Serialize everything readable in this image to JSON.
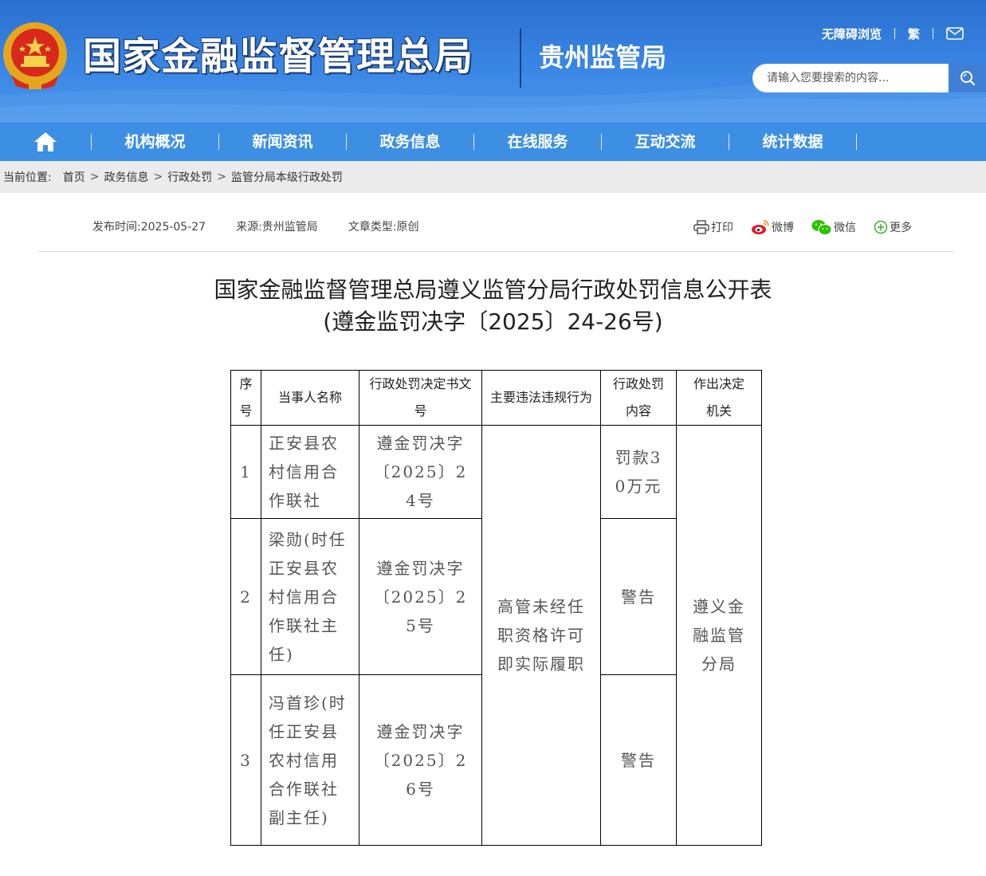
{
  "header": {
    "main_title": "国家金融监督管理总局",
    "sub_title": "贵州监管局",
    "links": {
      "accessibility": "无障碍浏览",
      "traditional": "繁"
    },
    "search_placeholder": "请输入您要搜索的内容..."
  },
  "nav": {
    "items": [
      {
        "label": "机构概况"
      },
      {
        "label": "新闻资讯"
      },
      {
        "label": "政务信息"
      },
      {
        "label": "在线服务"
      },
      {
        "label": "互动交流"
      },
      {
        "label": "统计数据"
      }
    ]
  },
  "breadcrumb": {
    "label": "当前位置:",
    "items": [
      "首页",
      "政务信息",
      "行政处罚",
      "监管分局本级行政处罚"
    ],
    "separator": ">"
  },
  "meta": {
    "publish_time": "发布时间:2025-05-27",
    "source": "来源:贵州监管局",
    "article_type": "文章类型:原创"
  },
  "share": {
    "print": "打印",
    "weibo": "微博",
    "wechat": "微信",
    "more": "更多"
  },
  "article": {
    "title_line1": "国家金融监督管理总局遵义监管分局行政处罚信息公开表",
    "title_line2": "(遵金监罚决字〔2025〕24-26号)"
  },
  "table": {
    "headers": [
      "序号",
      "当事人名称",
      "行政处罚决定书文号",
      "主要违法违规行为",
      "行政处罚内容",
      "作出决定机关"
    ],
    "rows": [
      {
        "no": "1",
        "party": "正安县农村信用合作联社",
        "doc": "遵金罚决字〔2025〕24号",
        "penalty": "罚款30万元"
      },
      {
        "no": "2",
        "party": "梁勋(时任正安县农村信用合作联社主任)",
        "doc": "遵金罚决字〔2025〕25号",
        "penalty": "警告"
      },
      {
        "no": "3",
        "party": "冯首珍(时任正安县农村信用合作联社副主任)",
        "doc": "遵金罚决字〔2025〕26号",
        "penalty": "警告"
      }
    ],
    "violation": "高管未经任职资格许可即实际履职",
    "authority": "遵义金融监管分局"
  },
  "colors": {
    "header_blue": "#3a86e4",
    "nav_blue": "#3d8fe4",
    "breadcrumb_bg": "#ebebeb"
  }
}
